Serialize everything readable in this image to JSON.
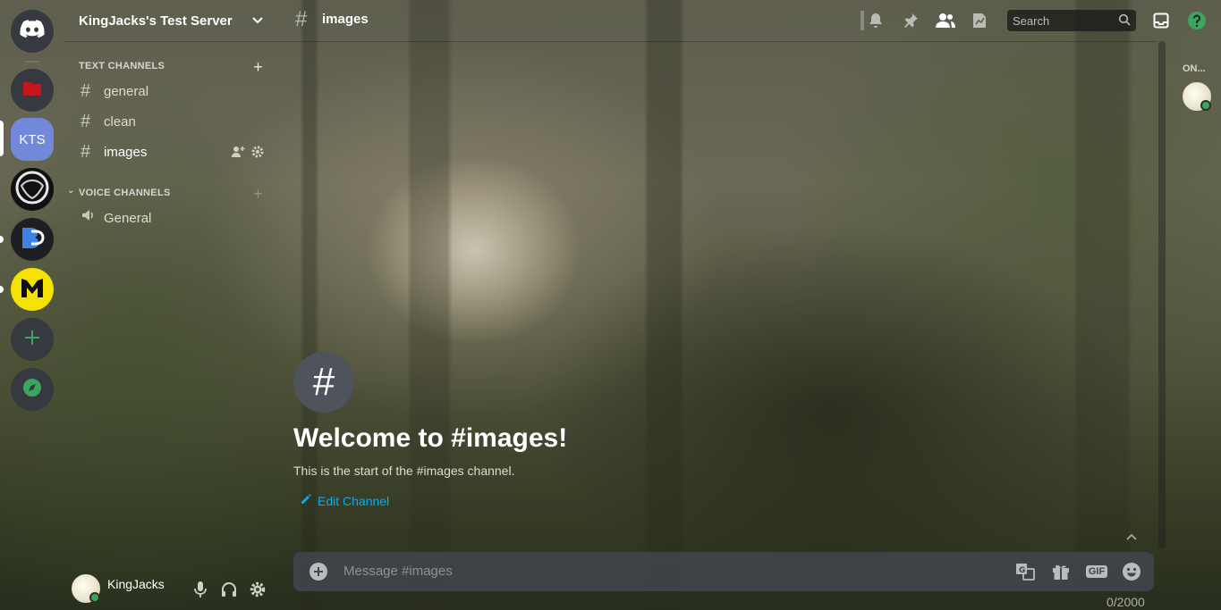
{
  "server": {
    "name": "KingJacks's Test Server",
    "rail": {
      "kts_label": "KTS",
      "accent": "#7289da"
    },
    "categories": {
      "text": "TEXT CHANNELS",
      "voice": "VOICE CHANNELS"
    },
    "text_channels": [
      {
        "name": "general"
      },
      {
        "name": "clean"
      },
      {
        "name": "images"
      }
    ],
    "voice_channels": [
      {
        "name": "General"
      }
    ]
  },
  "header": {
    "channel_name": "images",
    "search_placeholder": "Search"
  },
  "welcome": {
    "title": "Welcome to #images!",
    "subtitle": "This is the start of the #images channel.",
    "edit_label": "Edit Channel"
  },
  "composer": {
    "placeholder": "Message #images",
    "gif_label": "GIF",
    "char_count": "0/2000"
  },
  "members": {
    "online_label": "ON..."
  },
  "user": {
    "name": "KingJacks"
  },
  "colors": {
    "link": "#00b0f4",
    "online": "#3ba55d",
    "help": "#3ba55d"
  },
  "icons": [
    "discord-home-icon",
    "add-server-icon",
    "explore-icon",
    "bell-icon",
    "pin-icon",
    "members-icon",
    "inbox-icon",
    "help-icon",
    "mic-icon",
    "headphones-icon",
    "settings-icon",
    "gift-icon",
    "emoji-icon",
    "translate-icon"
  ]
}
